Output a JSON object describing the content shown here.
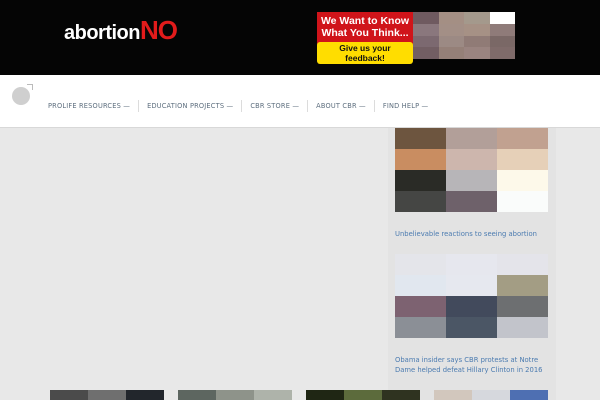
{
  "header": {
    "logo": {
      "part1": "abortion",
      "part2": "NO"
    },
    "banner": {
      "line1": "We Want to Know",
      "line2": "What You Think...",
      "button": "Give us your feedback!",
      "pixel_colors": [
        "#6f5a60",
        "#a48f84",
        "#a4998c",
        "#ffffff",
        "#8a777d",
        "#a38f86",
        "#a69185",
        "#8f7b79",
        "#7c6970",
        "#9c8a84",
        "#907b76",
        "#7a6866",
        "#725e63",
        "#958078",
        "#9a8480",
        "#7f6b6a"
      ]
    }
  },
  "nav": {
    "icon": "bomb-icon",
    "items": [
      {
        "label": "PROLIFE RESOURCES —"
      },
      {
        "label": "EDUCATION PROJECTS —"
      },
      {
        "label": "CBR STORE —"
      },
      {
        "label": "ABOUT CBR —"
      },
      {
        "label": "FIND HELP —"
      }
    ]
  },
  "sidebar": {
    "thumb1": {
      "colors": [
        "#6d553f",
        "#b29f99",
        "#c1a190",
        "#c98d61",
        "#cdb6ad",
        "#e6d0b8",
        "#2a2b26",
        "#b7b5b8",
        "#fdf9ea",
        "#454644",
        "#6e616a",
        "#fafcfb"
      ],
      "caption": "Unbelievable reactions to seeing abortion"
    },
    "thumb2": {
      "colors": [
        "#e4e5ea",
        "#e6e7ee",
        "#e4e4ea",
        "#e1e7ef",
        "#e6e8ef",
        "#a39d84",
        "#7d6271",
        "#424a5c",
        "#6d6f71",
        "#8b8f96",
        "#4b5665",
        "#c2c4cb"
      ],
      "caption": "Obama insider says CBR protests at Notre Dame helped defeat Hillary Clinton in 2016"
    }
  },
  "bottom_strip": [
    {
      "colors": [
        "#4b4b4b",
        "#6f6f6f",
        "#22262c"
      ]
    },
    {
      "colors": [
        "#5d6660",
        "#8e938a",
        "#aeb3aa"
      ]
    },
    {
      "colors": [
        "#1f2614",
        "#5c6b3c",
        "#2f3320"
      ]
    },
    {
      "colors": [
        "#d2c7bd",
        "#d6d8dd",
        "#4e6fb2"
      ]
    }
  ]
}
